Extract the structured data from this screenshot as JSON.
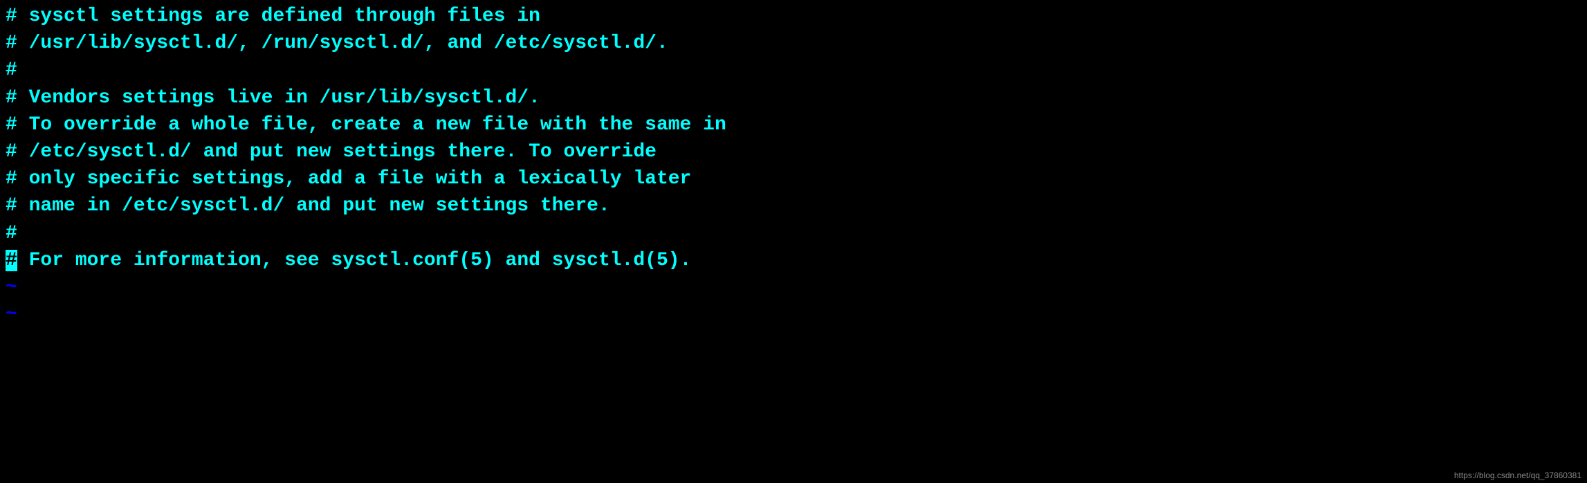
{
  "editor": {
    "lines": [
      "# sysctl settings are defined through files in",
      "# /usr/lib/sysctl.d/, /run/sysctl.d/, and /etc/sysctl.d/.",
      "#",
      "# Vendors settings live in /usr/lib/sysctl.d/.",
      "# To override a whole file, create a new file with the same in",
      "# /etc/sysctl.d/ and put new settings there. To override",
      "# only specific settings, add a file with a lexically later",
      "# name in /etc/sysctl.d/ and put new settings there.",
      "#"
    ],
    "cursor_line": {
      "cursor_char": "#",
      "rest": " For more information, see sysctl.conf(5) and sysctl.d(5)."
    },
    "tilde_lines": [
      "~",
      "~"
    ]
  },
  "watermark": "https://blog.csdn.net/qq_37860381"
}
